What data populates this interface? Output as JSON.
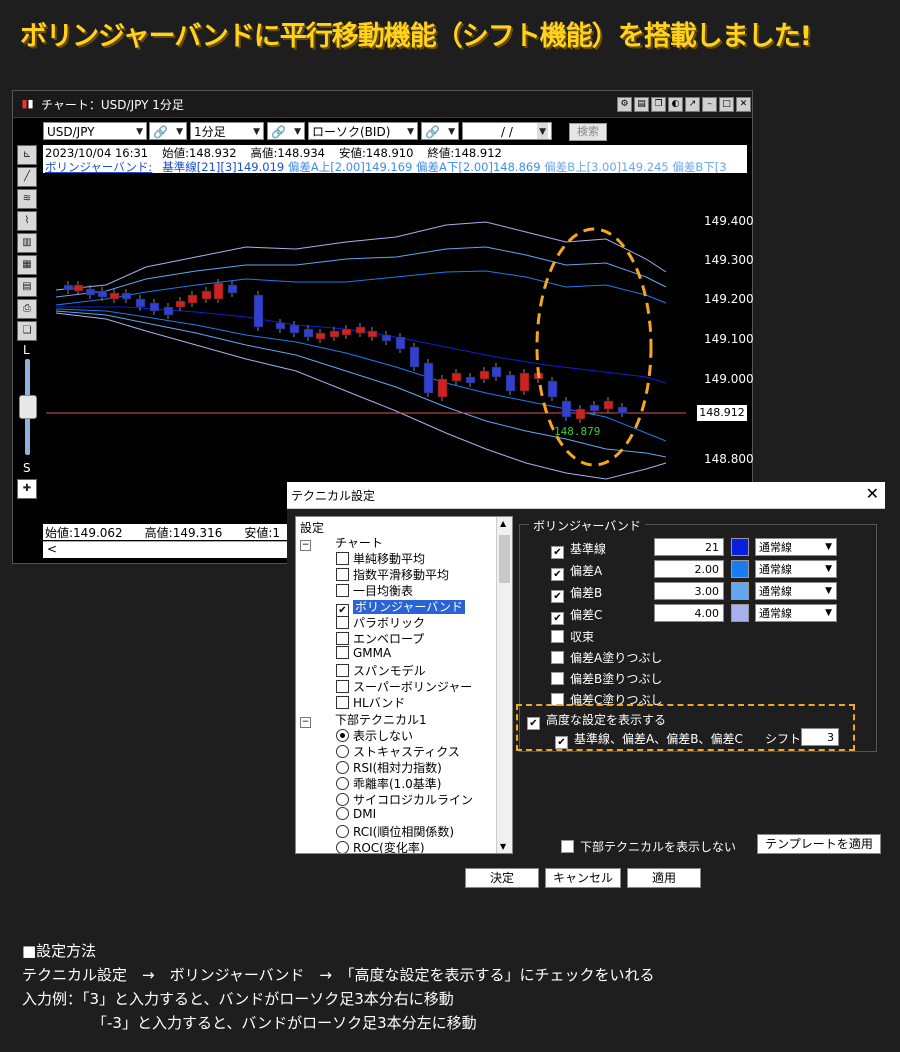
{
  "headline": "ボリンジャーバンドに平行移動機能（シフト機能）を搭載しました!",
  "chart_window": {
    "title": "チャート：USD/JPY 1分足",
    "toolbar": {
      "pair": "USD/JPY",
      "timeframe": "1分足",
      "chart_type": "ローソク(BID)",
      "date": "/ /",
      "search_label": "検索"
    },
    "info_line1": [
      "2023/10/04 16:31",
      "始値:148.932",
      "高値:148.934",
      "安値:148.910",
      "終値:148.912"
    ],
    "info_line2": {
      "label": "ボリンジャーバンド:",
      "basis": "基準線[21][3]149.019",
      "dev_a": "偏差A上[2.00]149.169 偏差A下[2.00]148.869",
      "dev_b": "偏差B上[3.00]149.245 偏差B下[3"
    },
    "price_ticks": [
      "149.400",
      "149.300",
      "149.200",
      "149.100",
      "149.000",
      "148.800"
    ],
    "current_price": "148.912",
    "low_marker": "148.879",
    "bottom_info": [
      "始値:149.062",
      "高値:149.316",
      "安値:1"
    ],
    "scroll_left": "<",
    "tools": {
      "L": "L",
      "S": "S"
    }
  },
  "dialog": {
    "title": "テクニカル設定",
    "tree": {
      "root": "設定",
      "chart_group": "チャート",
      "chart_items": [
        {
          "label": "単純移動平均",
          "checked": false
        },
        {
          "label": "指数平滑移動平均",
          "checked": false
        },
        {
          "label": "一目均衡表",
          "checked": false
        },
        {
          "label": "ボリンジャーバンド",
          "checked": true
        },
        {
          "label": "パラボリック",
          "checked": false
        },
        {
          "label": "エンベロープ",
          "checked": false
        },
        {
          "label": "GMMA",
          "checked": false
        },
        {
          "label": "スパンモデル",
          "checked": false
        },
        {
          "label": "スーパーボリンジャー",
          "checked": false
        },
        {
          "label": "HLバンド",
          "checked": false
        }
      ],
      "lower_group": "下部テクニカル1",
      "lower_items": [
        {
          "label": "表示しない",
          "selected": true
        },
        {
          "label": "ストキャスティクス",
          "selected": false
        },
        {
          "label": "RSI(相対力指数)",
          "selected": false
        },
        {
          "label": "乖離率(1.0基準)",
          "selected": false
        },
        {
          "label": "サイコロジカルライン",
          "selected": false
        },
        {
          "label": "DMI",
          "selected": false
        },
        {
          "label": "RCI(順位相関係数)",
          "selected": false
        },
        {
          "label": "ROC(変化率)",
          "selected": false
        }
      ]
    },
    "group_label": "ボリンジャーバンド",
    "rows": [
      {
        "label": "基準線",
        "checked": true,
        "value": "21",
        "color": "#0a1ee0",
        "line": "通常線"
      },
      {
        "label": "偏差A",
        "checked": true,
        "value": "2.00",
        "color": "#1a7cf0",
        "line": "通常線"
      },
      {
        "label": "偏差B",
        "checked": true,
        "value": "3.00",
        "color": "#5fa8f0",
        "line": "通常線"
      },
      {
        "label": "偏差C",
        "checked": true,
        "value": "4.00",
        "color": "#a8b0f0",
        "line": "通常線"
      }
    ],
    "options": [
      "収束",
      "偏差A塗りつぶし",
      "偏差B塗りつぶし",
      "偏差C塗りつぶし"
    ],
    "advanced_label": "高度な設定を表示する",
    "advanced_sub": "基準線、偏差A、偏差B、偏差C",
    "shift_label": "シフト",
    "shift_value": "3",
    "hide_lower_label": "下部テクニカルを表示しない",
    "template_button": "テンプレートを適用",
    "ok": "決定",
    "cancel": "キャンセル",
    "apply": "適用"
  },
  "instructions": {
    "heading": "■設定方法",
    "line1": "テクニカル設定　→　ボリンジャーバンド　→　「高度な設定を表示する」にチェックをいれる",
    "line2": "入力例：「3」と入力すると、バンドがローソク足3本分右に移動",
    "line3": "「-3」と入力すると、バンドがローソク足3本分左に移動"
  }
}
